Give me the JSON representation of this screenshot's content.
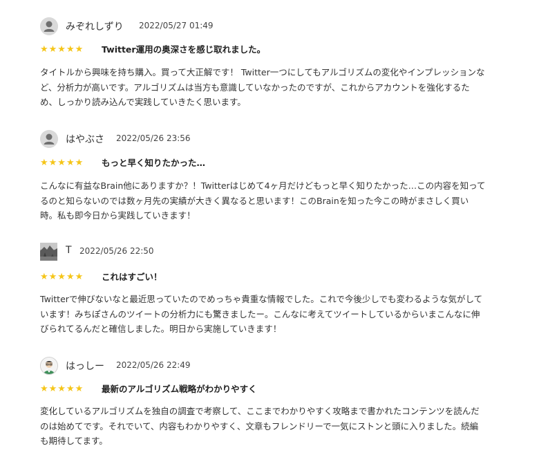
{
  "reviews": [
    {
      "username": "みぞれしずり",
      "date": "2022/05/27 01:49",
      "avatar": "default-user-icon",
      "rating": 5,
      "stars": "★★★★★",
      "title": "Twitter運用の奥深さを感じ取れました。",
      "body": "タイトルから興味を持ち購入。買って大正解です！ Twitter一つにしてもアルゴリズムの変化やインプレッションなど、分析力が高いです。アルゴリズムは当方も意識していなかったのですが、これからアカウントを強化するため、しっかり読み込んで実践していきたく思います。"
    },
    {
      "username": "はやぶさ",
      "date": "2022/05/26 23:56",
      "avatar": "default-user-icon",
      "rating": 5,
      "stars": "★★★★★",
      "title": "もっと早く知りたかった…",
      "body": "こんなに有益なBrain他にありますか？！Twitterはじめて4ヶ月だけどもっと早く知りたかった…この内容を知ってるのと知らないのでは数ヶ月先の実績が大きく異なると思います！このBrainを知った今この時がまさしく買い時。私も即今日から実践していきます！"
    },
    {
      "username": "T",
      "date": "2022/05/26 22:50",
      "avatar": "photo-avatar",
      "rating": 5,
      "stars": "★★★★★",
      "title": "これはすごい！",
      "body": "Twitterで伸びないなと最近思っていたのでめっちゃ貴重な情報でした。これで今後少しでも変わるような気がしています！みちぽさんのツイートの分析力にも驚きましたー。こんなに考えてツイートしているからいまこんなに伸びられてるんだと確信しました。明日から実施していきます！"
    },
    {
      "username": "はっしー",
      "date": "2022/05/26 22:49",
      "avatar": "illustrated-avatar",
      "rating": 5,
      "stars": "★★★★★",
      "title": "最新のアルゴリズム戦略がわかりやすく",
      "body": "変化しているアルゴリズムを独自の調査で考察して、ここまでわかりやすく攻略まで書かれたコンテンツを読んだのは始めてです。それでいて、内容もわかりやすく、文章もフレンドリーで一気にストンと頭に入りました。続編も期待してます。"
    }
  ],
  "colors": {
    "star": "#f5c518",
    "text": "#333333",
    "avatar_bg": "#d9d9d9",
    "avatar_fg": "#8a8a8a"
  }
}
